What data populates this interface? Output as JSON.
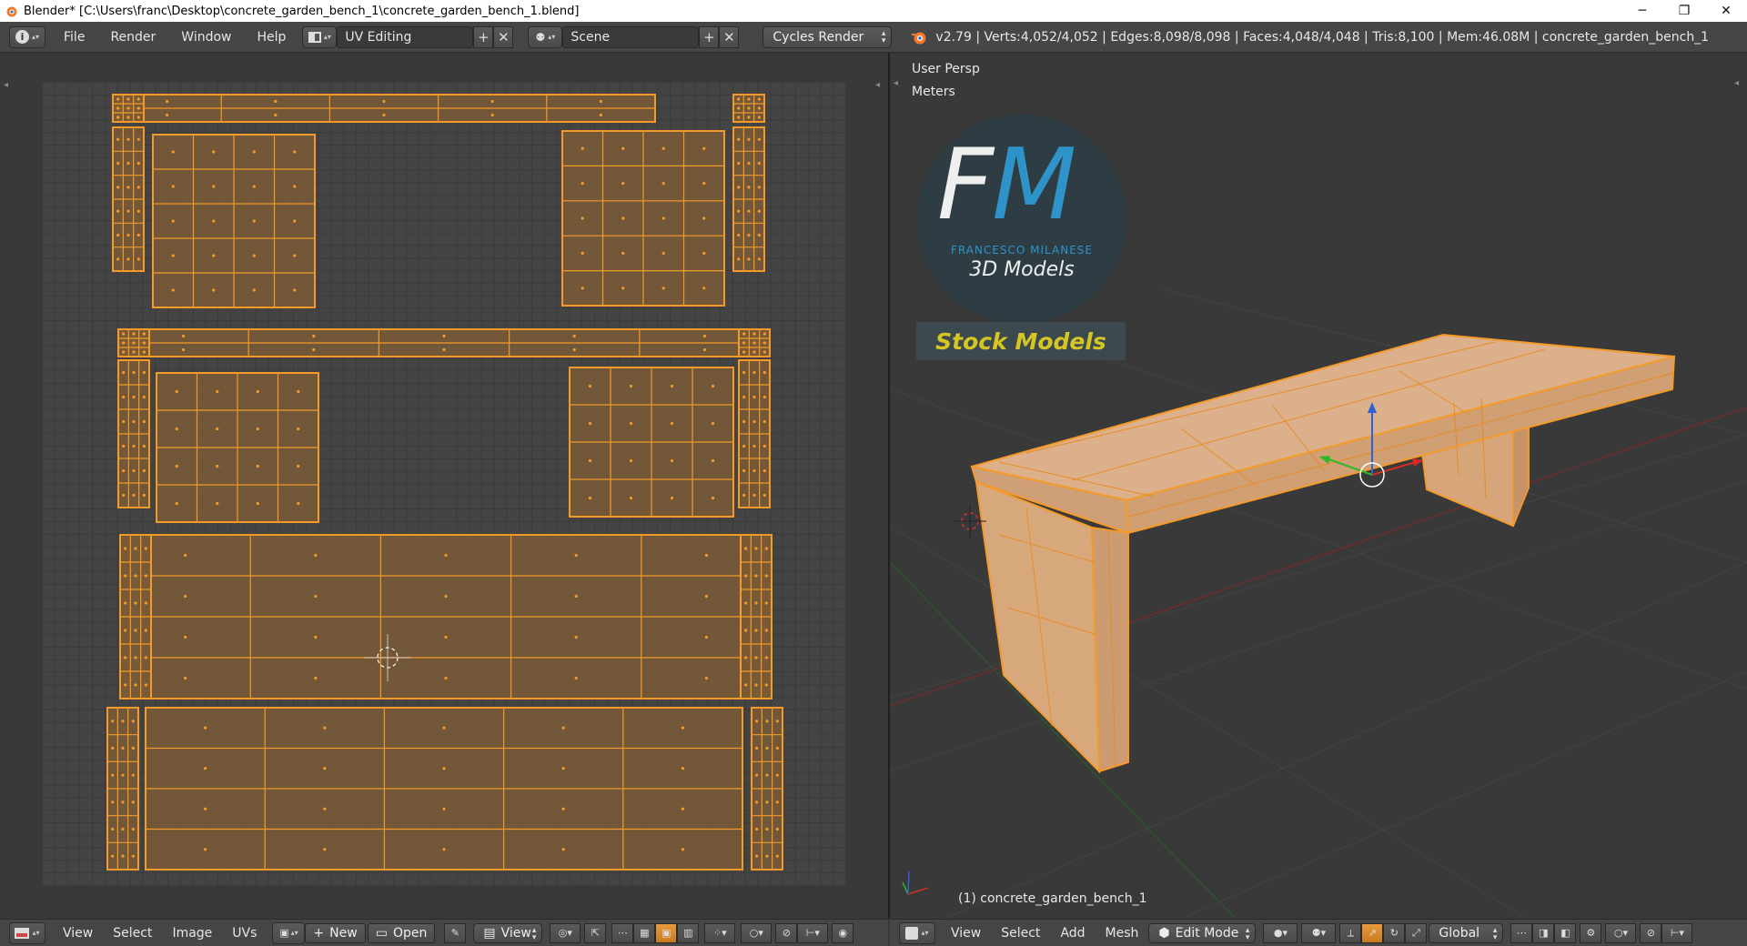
{
  "window": {
    "title": "Blender* [C:\\Users\\franc\\Desktop\\concrete_garden_bench_1\\concrete_garden_bench_1.blend]",
    "minimize": "─",
    "maximize": "❐",
    "close": "✕"
  },
  "topbar": {
    "menus": [
      "File",
      "Render",
      "Window",
      "Help"
    ],
    "layout": "UV Editing",
    "scene": "Scene",
    "engine": "Cycles Render",
    "stats": "v2.79 | Verts:4,052/4,052 | Edges:8,098/8,098 | Faces:4,048/4,048 | Tris:8,100 | Mem:46.08M | concrete_garden_bench_1"
  },
  "uv_editor": {
    "menus": [
      "View",
      "Select",
      "Image",
      "UVs"
    ],
    "new_label": "New",
    "open_label": "Open",
    "view_label": "View"
  },
  "viewport": {
    "view_name": "User Persp",
    "units": "Meters",
    "object_label": "(1) concrete_garden_bench_1",
    "watermark": {
      "logo": "FM",
      "brand": "FRANCESCO MILANESE",
      "subtitle": "3D Models",
      "banner": "Stock Models"
    },
    "menus": [
      "View",
      "Select",
      "Add",
      "Mesh"
    ],
    "mode": "Edit Mode",
    "orientation": "Global"
  },
  "colors": {
    "uv_orange": "#f39a2a",
    "uv_fill": "#7a5a37",
    "mesh_fill": "#d8a77a",
    "banner_text": "#d6c623",
    "logo_blue": "#2e9bd6"
  }
}
